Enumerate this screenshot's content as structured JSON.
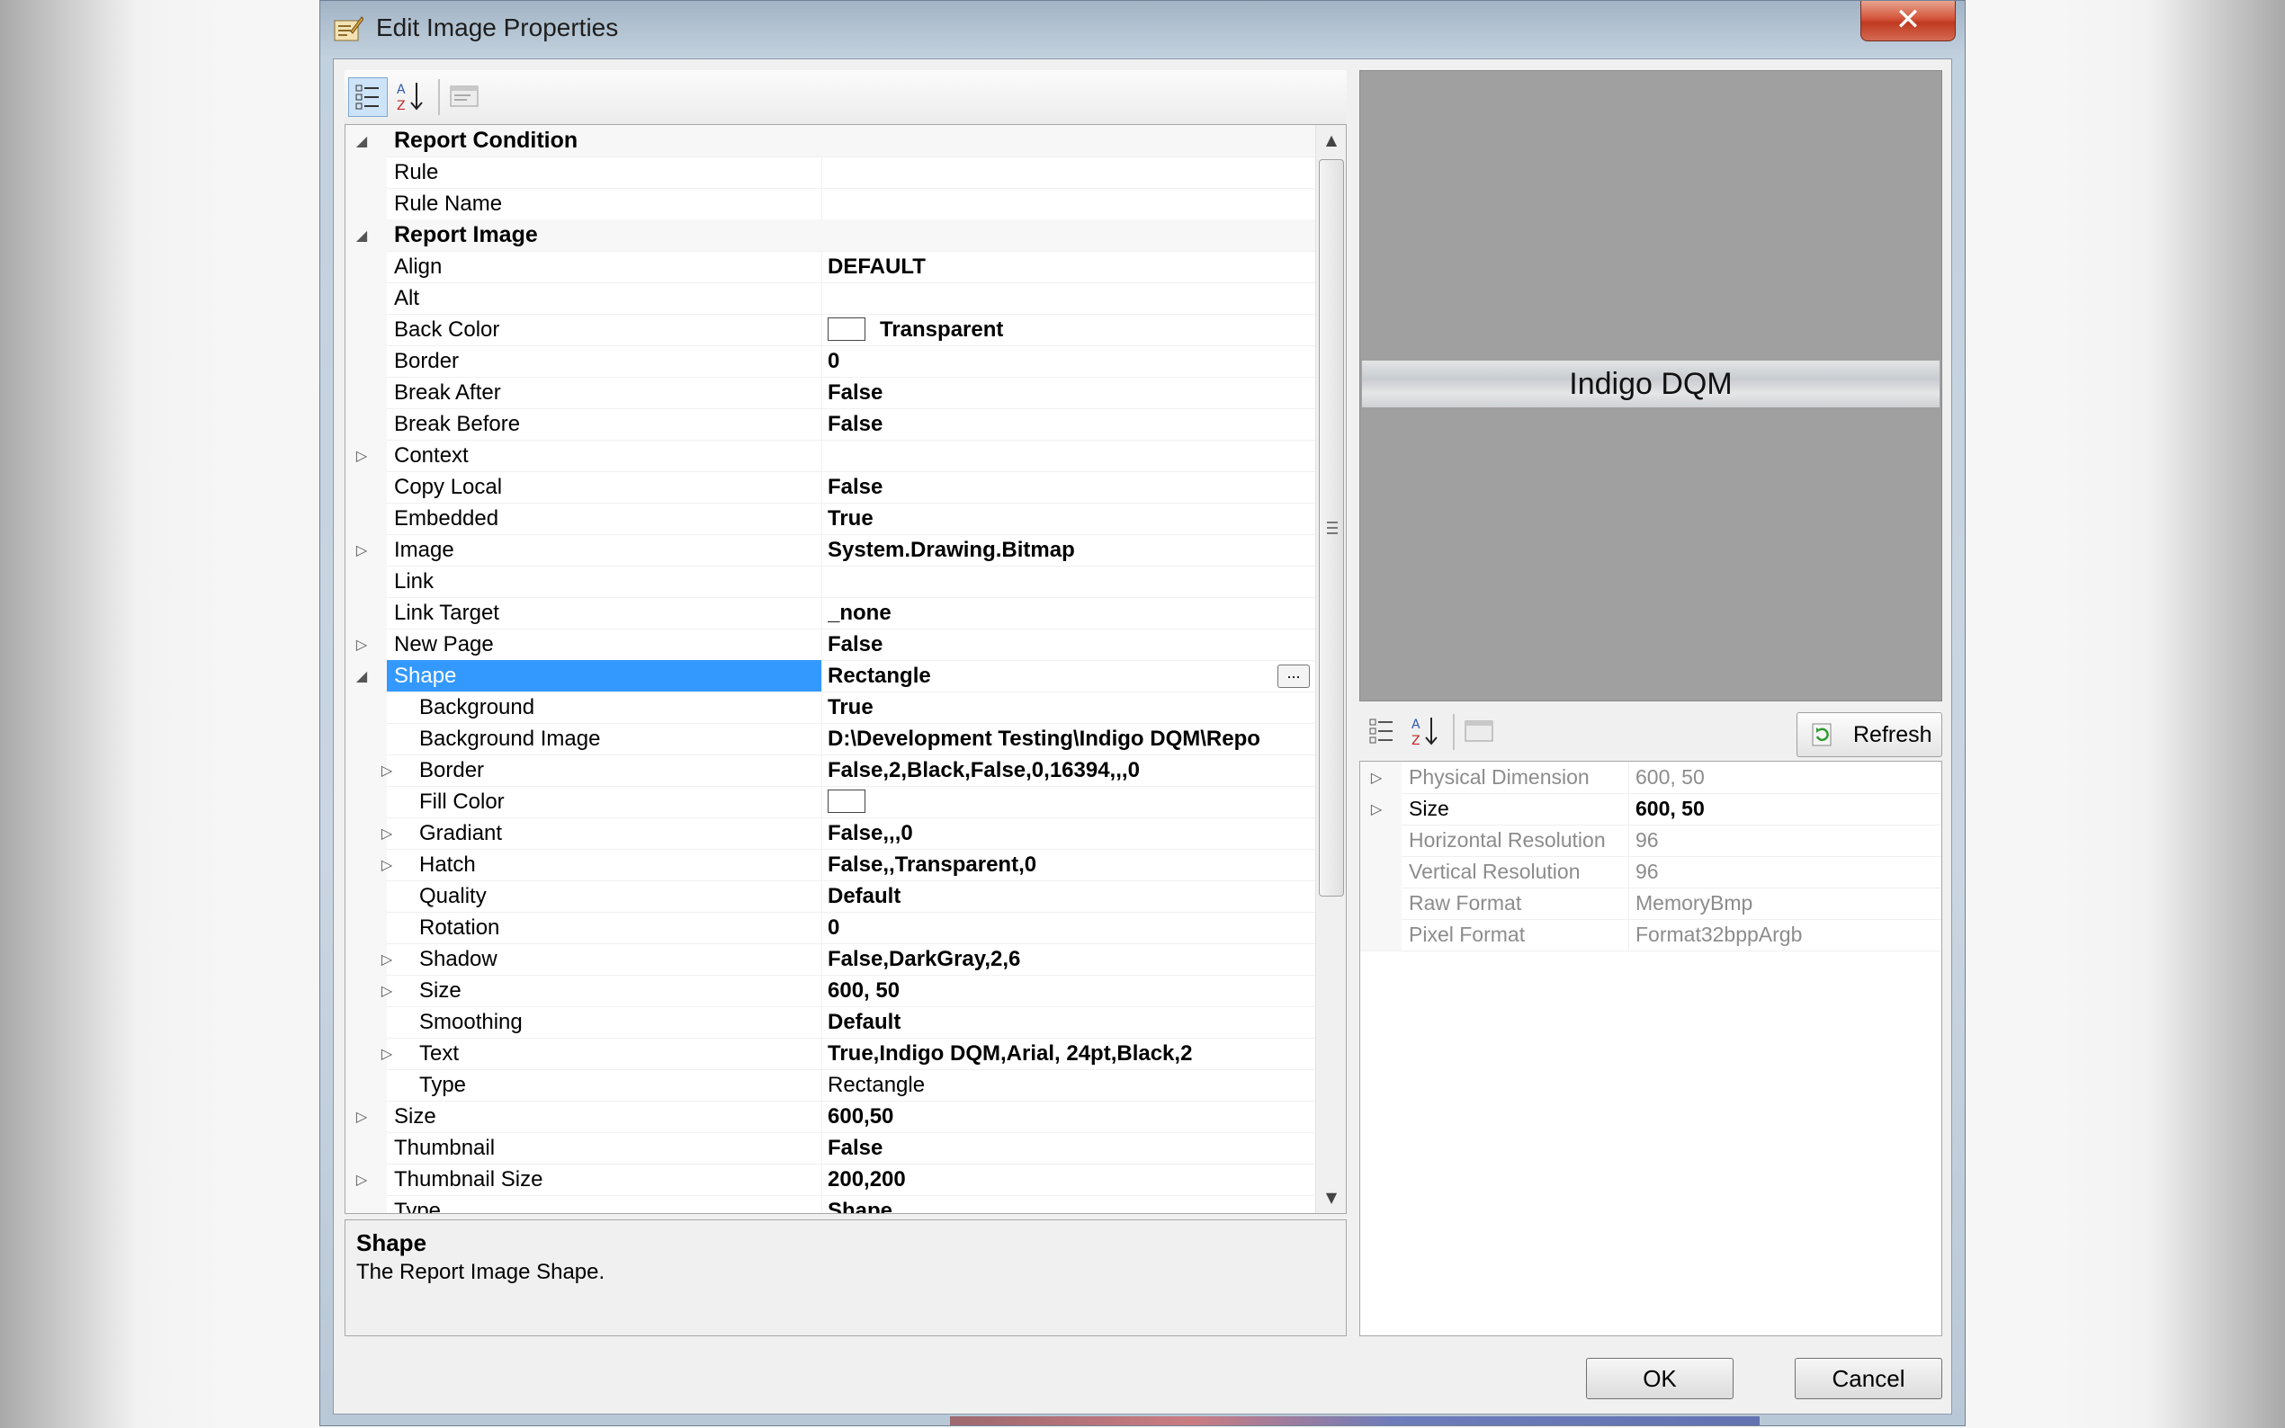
{
  "window": {
    "title": "Edit Image Properties",
    "close_glyph": "✕"
  },
  "grid": {
    "rows": [
      {
        "type": "category",
        "name": "Report Condition",
        "expander": "◢"
      },
      {
        "name": "Rule",
        "value": ""
      },
      {
        "name": "Rule Name",
        "value": ""
      },
      {
        "type": "category",
        "name": "Report Image",
        "expander": "◢"
      },
      {
        "name": "Align",
        "value": "DEFAULT"
      },
      {
        "name": "Alt",
        "value": ""
      },
      {
        "name": "Back Color",
        "value": "Transparent",
        "swatch": true
      },
      {
        "name": "Border",
        "value": "0"
      },
      {
        "name": "Break After",
        "value": "False"
      },
      {
        "name": "Break Before",
        "value": "False"
      },
      {
        "name": "Context",
        "value": "",
        "expander": "▷"
      },
      {
        "name": "Copy Local",
        "value": "False"
      },
      {
        "name": "Embedded",
        "value": "True"
      },
      {
        "name": "Image",
        "value": "System.Drawing.Bitmap",
        "expander": "▷"
      },
      {
        "name": "Link",
        "value": ""
      },
      {
        "name": "Link Target",
        "value": "_none"
      },
      {
        "name": "New Page",
        "value": "False",
        "expander": "▷"
      },
      {
        "name": "Shape",
        "value": "Rectangle",
        "expander": "◢",
        "selected": true,
        "ellipsis": "..."
      },
      {
        "name": "Background",
        "value": "True",
        "indent": true
      },
      {
        "name": "Background Image",
        "value": "D:\\Development Testing\\Indigo DQM\\Repo",
        "indent": true
      },
      {
        "name": "Border",
        "value": "False,2,Black,False,0,16394,,,0",
        "indent": true,
        "expander": "▷"
      },
      {
        "name": "Fill Color",
        "value": "",
        "indent": true,
        "swatch": true
      },
      {
        "name": "Gradiant",
        "value": "False,,,0",
        "indent": true,
        "expander": "▷"
      },
      {
        "name": "Hatch",
        "value": "False,,Transparent,0",
        "indent": true,
        "expander": "▷"
      },
      {
        "name": "Quality",
        "value": "Default",
        "indent": true
      },
      {
        "name": "Rotation",
        "value": "0",
        "indent": true
      },
      {
        "name": "Shadow",
        "value": "False,DarkGray,2,6",
        "indent": true,
        "expander": "▷"
      },
      {
        "name": "Size",
        "value": "600, 50",
        "indent": true,
        "expander": "▷"
      },
      {
        "name": "Smoothing",
        "value": "Default",
        "indent": true
      },
      {
        "name": "Text",
        "value": "True,Indigo DQM,Arial, 24pt,Black,2",
        "indent": true,
        "expander": "▷"
      },
      {
        "name": "Type",
        "value": "Rectangle",
        "indent": true,
        "normal": true
      },
      {
        "name": "Size",
        "value": "600,50",
        "expander": "▷"
      },
      {
        "name": "Thumbnail",
        "value": "False"
      },
      {
        "name": "Thumbnail Size",
        "value": "200,200",
        "expander": "▷"
      },
      {
        "name": "Type",
        "value": "Shape"
      }
    ],
    "scroll_up": "▲",
    "scroll_down": "▼"
  },
  "description": {
    "title": "Shape",
    "text": "The Report Image Shape."
  },
  "preview": {
    "banner_text": "Indigo DQM"
  },
  "info": {
    "refresh_label": "Refresh",
    "rows": [
      {
        "name": "Physical Dimension",
        "value": "600, 50",
        "expander": "▷"
      },
      {
        "name": "Size",
        "value": "600, 50",
        "expander": "▷",
        "bold": true
      },
      {
        "name": "Horizontal Resolution",
        "value": "96"
      },
      {
        "name": "Vertical Resolution",
        "value": "96"
      },
      {
        "name": "Raw Format",
        "value": "MemoryBmp"
      },
      {
        "name": "Pixel Format",
        "value": "Format32bppArgb"
      }
    ]
  },
  "buttons": {
    "ok": "OK",
    "cancel": "Cancel"
  },
  "icons": {
    "categorized": "categorized-icon",
    "alphabetical": "sort-alphabetical-icon",
    "property_pages": "property-pages-icon",
    "refresh": "refresh-icon",
    "window": "edit-properties-icon"
  },
  "colors": {
    "selection": "#3399ff",
    "preview_bg": "#a0a0a0"
  }
}
